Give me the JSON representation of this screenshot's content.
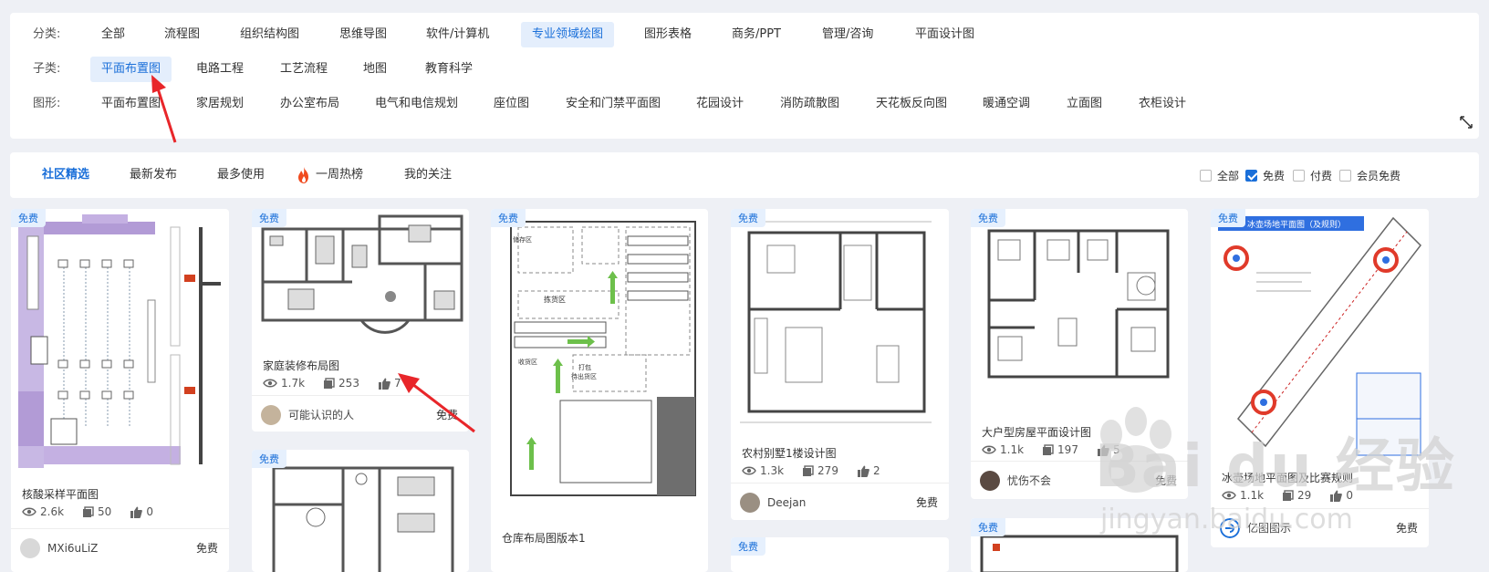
{
  "filters": {
    "category": {
      "label": "分类:",
      "items": [
        "全部",
        "流程图",
        "组织结构图",
        "思维导图",
        "软件/计算机",
        "专业领域绘图",
        "图形表格",
        "商务/PPT",
        "管理/咨询",
        "平面设计图"
      ],
      "active": 5
    },
    "subcategory": {
      "label": "子类:",
      "items": [
        "平面布置图",
        "电路工程",
        "工艺流程",
        "地图",
        "教育科学"
      ],
      "active": 0
    },
    "shape": {
      "label": "图形:",
      "items": [
        "平面布置图",
        "家居规划",
        "办公室布局",
        "电气和电信规划",
        "座位图",
        "安全和门禁平面图",
        "花园设计",
        "消防疏散图",
        "天花板反向图",
        "暖通空调",
        "立面图",
        "衣柜设计"
      ]
    }
  },
  "tabs": {
    "items": [
      "社区精选",
      "最新发布",
      "最多使用",
      "一周热榜",
      "我的关注"
    ],
    "active": 0
  },
  "price_filters": [
    {
      "label": "全部",
      "checked": false
    },
    {
      "label": "免费",
      "checked": true
    },
    {
      "label": "付费",
      "checked": false
    },
    {
      "label": "会员免费",
      "checked": false
    }
  ],
  "cards": [
    {
      "tag": "免费",
      "title": "核酸采样平面图",
      "views": "2.6k",
      "copies": "50",
      "likes": "0",
      "author": "MXi6uLiZ",
      "price": "免费"
    },
    {
      "tag": "免费",
      "title": "家庭装修布局图",
      "views": "1.7k",
      "copies": "253",
      "likes": "7",
      "author": "可能认识的人",
      "price": "免费"
    },
    {
      "tag": "免费",
      "title": "仓库布局图版本1"
    },
    {
      "tag": "免费",
      "title": "农村别墅1楼设计图",
      "views": "1.3k",
      "copies": "279",
      "likes": "2",
      "author": "Deejan",
      "price": "免费"
    },
    {
      "tag": "免费",
      "title": "大户型房屋平面设计图",
      "views": "1.1k",
      "copies": "197",
      "likes": "5",
      "author": "忧伤不会",
      "price": "免费"
    },
    {
      "tag": "免费",
      "title": "冰壶场地平面图及比赛规则",
      "views": "1.1k",
      "copies": "29",
      "likes": "0",
      "author": "亿图图示",
      "price": "免费"
    },
    {
      "tag": "免费"
    },
    {
      "tag": "免费"
    },
    {
      "tag": "免费"
    }
  ],
  "thumb_text": {
    "warehouse": [
      "收货区",
      "打包",
      "待出货区",
      "拣货区",
      "储存区"
    ],
    "curling": "冰壶场地平面图（及规则）"
  },
  "watermark": {
    "brand": "Bai du 经验",
    "url": "jingyan.baidu.com"
  },
  "colors": {
    "accent": "#1a6fd9",
    "active_chip_bg": "#e4eefc",
    "annotation_arrow": "#e8262a"
  }
}
